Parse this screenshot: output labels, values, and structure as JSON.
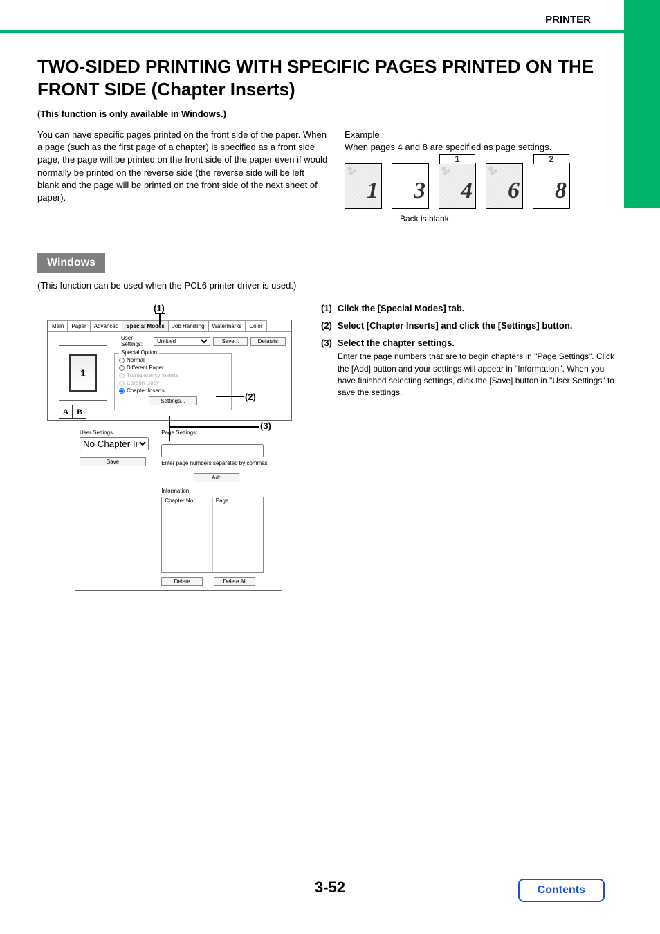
{
  "header": {
    "section": "PRINTER"
  },
  "title": "TWO-SIDED PRINTING WITH SPECIFIC PAGES PRINTED ON THE FRONT SIDE (Chapter Inserts)",
  "windows_only_note": "(This function is only available in Windows.)",
  "intro_text": "You can have specific pages printed on the front side of the paper.\nWhen a page (such as the first page of a chapter) is specified as a front side page, the page will be printed on the front side of the paper even if would normally be printed on the reverse side (the reverse side will be left blank and the page will be printed on the front side of the next sheet of paper).",
  "example": {
    "label": "Example:",
    "desc": "When pages 4 and 8 are specified as page settings.",
    "sheets": [
      {
        "big": "1"
      },
      {
        "big": "3"
      },
      {
        "big": "4",
        "tab": "1"
      },
      {
        "big": "6"
      },
      {
        "big": "8",
        "tab": "2"
      }
    ],
    "back_blank": "Back is blank"
  },
  "windows_section": {
    "heading": "Windows",
    "note": "(This function can be used when the PCL6 printer driver is used.)"
  },
  "callouts": [
    "(1)",
    "(2)",
    "(3)"
  ],
  "dialog": {
    "tabs": [
      "Main",
      "Paper",
      "Advanced",
      "Special Modes",
      "Job Handling",
      "Watermarks",
      "Color"
    ],
    "user_settings_label": "User Settings:",
    "user_settings_value": "Untitled",
    "save_btn": "Save...",
    "defaults_btn": "Defaults",
    "group_legend": "Special Option",
    "options": [
      "Normal",
      "Different Paper",
      "Transparency Inserts",
      "Carbon Copy",
      "Chapter Inserts"
    ],
    "settings_btn": "Settings..."
  },
  "sub": {
    "user_settings_label": "User Settings",
    "preset": "No Chapter Inserts",
    "save_btn": "Save",
    "page_settings_label": "Page Settings:",
    "hint": "Enter page numbers separated by commas.",
    "add_btn": "Add",
    "info_label": "Information",
    "col_chapter": "Chapter No.",
    "col_page": "Page",
    "delete_btn": "Delete",
    "delete_all_btn": "Delete All"
  },
  "steps": [
    {
      "num": "(1)",
      "head": "Click the [Special Modes] tab."
    },
    {
      "num": "(2)",
      "head": "Select [Chapter Inserts] and click the [Settings] button."
    },
    {
      "num": "(3)",
      "head": "Select the chapter settings.",
      "body": "Enter the page numbers that are to begin chapters in \"Page Settings\". Click the [Add] button and your settings will appear in \"Information\". When you have finished selecting settings, click the [Save] button in \"User Settings\" to save the settings."
    }
  ],
  "footer": {
    "page": "3-52",
    "contents": "Contents"
  }
}
